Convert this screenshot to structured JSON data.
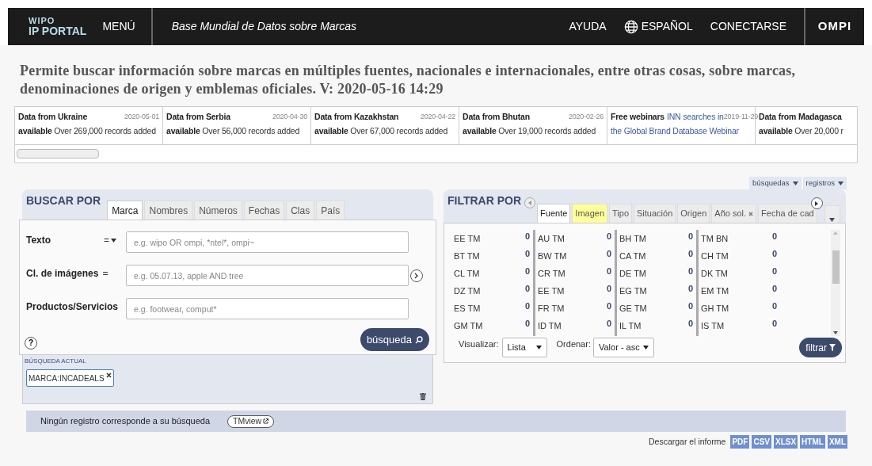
{
  "header": {
    "logo_top": "WIPO",
    "logo_bottom": "IP PORTAL",
    "menu": "MENÚ",
    "title": "Base Mundial de Datos sobre Marcas",
    "links": [
      {
        "label": "AYUDA",
        "kind": "text"
      },
      {
        "label": "ESPAÑOL",
        "kind": "language"
      },
      {
        "label": "CONECTARSE",
        "kind": "text"
      }
    ],
    "brand": "OMPI"
  },
  "description": "Permite buscar información sobre marcas en múltiples fuentes, nacionales e internacionales, entre otras cosas, sobre marcas, denominaciones de origen y emblemas oficiales. V: 2020-05-16 14:29",
  "news": [
    {
      "kind": "update",
      "title": "Data from Ukraine",
      "date": "2020-05-01",
      "lead": "available",
      "text": "Over 269,000 records added"
    },
    {
      "kind": "update",
      "title": "Data from Serbia",
      "date": "2020-04-30",
      "lead": "available",
      "text": "Over 56,000 records added"
    },
    {
      "kind": "update",
      "title": "Data from Kazakhstan",
      "date": "2020-04-22",
      "lead": "available",
      "text": "Over 67,000 records added"
    },
    {
      "kind": "update",
      "title": "Data from Bhutan",
      "date": "2020-02-26",
      "lead": "available",
      "text": "Over 19,000 records added"
    },
    {
      "kind": "webinar",
      "title": "Free webinars",
      "title_link": "INN searches in",
      "date": "2019-11-29",
      "text": "the Global Brand Database Webinar"
    },
    {
      "kind": "update",
      "title": "Data from Madagasca",
      "lead": "available",
      "text": "Over 20,000 r"
    }
  ],
  "view_menus": [
    "búsquedas",
    "registros"
  ],
  "search": {
    "heading": "BUSCAR POR",
    "tabs": [
      {
        "label": "Marca",
        "selected": true
      },
      {
        "label": "Nombres",
        "selected": false
      },
      {
        "label": "Números",
        "selected": false
      },
      {
        "label": "Fechas",
        "selected": false
      },
      {
        "label": "Clas",
        "selected": false
      },
      {
        "label": "País",
        "selected": false
      }
    ],
    "fields": [
      {
        "label": "Texto",
        "operator": "=",
        "operator_menu": true,
        "placeholder": "e.g. wipo OR ompi, *ntel*, ompi~"
      },
      {
        "label": "Cl. de imágenes",
        "operator": "=",
        "operator_menu": false,
        "placeholder": "e.g. 05.07.13, apple AND tree",
        "next": true
      },
      {
        "label": "Productos/Servicios",
        "placeholder": "e.g. footwear, comput*"
      }
    ],
    "help": "?",
    "button": "búsqueda",
    "current_heading": "BÚSQUEDA ACTUAL",
    "chips": [
      "MARCA:INCADEALS"
    ]
  },
  "filter": {
    "heading": "FILTRAR POR",
    "tabs": [
      {
        "label": "Fuente",
        "selected": true
      },
      {
        "label": "Imagen",
        "selected": false,
        "highlighted": true
      },
      {
        "label": "Tipo",
        "selected": false
      },
      {
        "label": "Situación",
        "selected": false
      },
      {
        "label": "Origen",
        "selected": false
      },
      {
        "label": "Año sol.",
        "selected": false,
        "removable": true
      },
      {
        "label": "Fecha de cad",
        "selected": false
      }
    ],
    "columns": [
      [
        {
          "label": "EE TM",
          "count": "0"
        },
        {
          "label": "BT TM",
          "count": "0"
        },
        {
          "label": "CL TM",
          "count": "0"
        },
        {
          "label": "DZ TM",
          "count": "0"
        },
        {
          "label": "ES TM",
          "count": "0"
        },
        {
          "label": "GM TM",
          "count": "0"
        }
      ],
      [
        {
          "label": "AU TM",
          "count": "0"
        },
        {
          "label": "BW TM",
          "count": "0"
        },
        {
          "label": "CR TM",
          "count": "0"
        },
        {
          "label": "EE TM",
          "count": "0"
        },
        {
          "label": "FR TM",
          "count": "0"
        },
        {
          "label": "ID TM",
          "count": "0"
        }
      ],
      [
        {
          "label": "BH TM",
          "count": "0"
        },
        {
          "label": "CA TM",
          "count": "0"
        },
        {
          "label": "DE TM",
          "count": "0"
        },
        {
          "label": "EG TM",
          "count": "0"
        },
        {
          "label": "GE TM",
          "count": "0"
        },
        {
          "label": "IL TM",
          "count": "0"
        }
      ],
      [
        {
          "label": "TM BN",
          "count": "0"
        },
        {
          "label": "CH TM",
          "count": "0"
        },
        {
          "label": "DK TM",
          "count": "0"
        },
        {
          "label": "EM TM",
          "count": "0"
        },
        {
          "label": "GH TM",
          "count": "0"
        },
        {
          "label": "IS TM",
          "count": "0"
        }
      ]
    ],
    "view_label": "Visualizar:",
    "view_value": "Lista",
    "sort_label": "Ordenar:",
    "sort_value": "Valor - asc",
    "button": "filtrar"
  },
  "results": {
    "message": "Ningún registro corresponde a su búsqueda",
    "link": "TMview"
  },
  "download": {
    "label": "Descargar el informe",
    "formats": [
      "PDF",
      "CSV",
      "XLSX",
      "HTML",
      "XML"
    ]
  }
}
